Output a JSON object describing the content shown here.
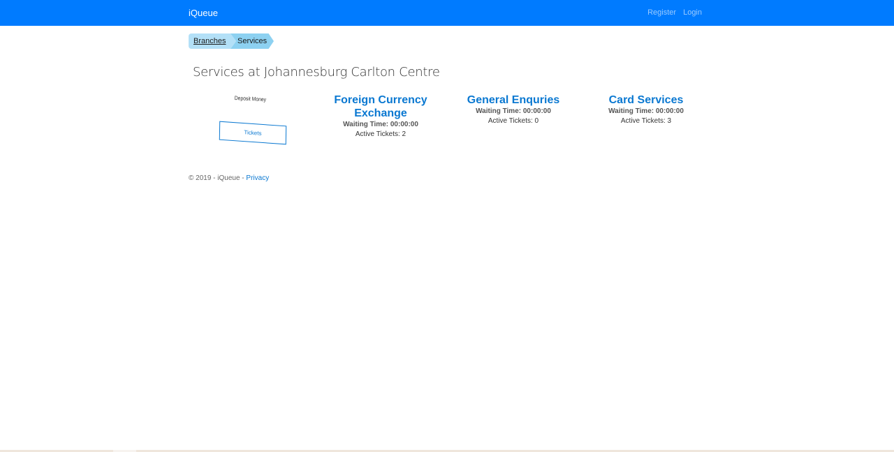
{
  "nav": {
    "brand": "iQueue",
    "links": [
      "Register",
      "Login"
    ],
    "background_color": "#007bff"
  },
  "breadcrumb": {
    "items": [
      "Branches",
      "Services"
    ]
  },
  "page": {
    "title": "Services at Johannesburg Carlton Centre"
  },
  "deposit_card": {
    "label": "Deposit Money",
    "button_label": "Tickets"
  },
  "services": [
    {
      "name": "Foreign Currency Exchange",
      "waiting": "Waiting Time: 00:00:00",
      "active": "Active Tickets: 2"
    },
    {
      "name": "General Enquries",
      "waiting": "Waiting Time: 00:00:00",
      "active": "Active Tickets: 0"
    },
    {
      "name": "Card Services",
      "waiting": "Waiting Time: 00:00:00",
      "active": "Active Tickets: 3"
    }
  ],
  "footer": {
    "copyright": "© 2019 - iQueue - ",
    "privacy_link": "Privacy"
  },
  "colors": {
    "accent": "#0a78d1",
    "breadcrumb_light": "#b3e0f7",
    "breadcrumb_active": "#8dd1f1"
  }
}
